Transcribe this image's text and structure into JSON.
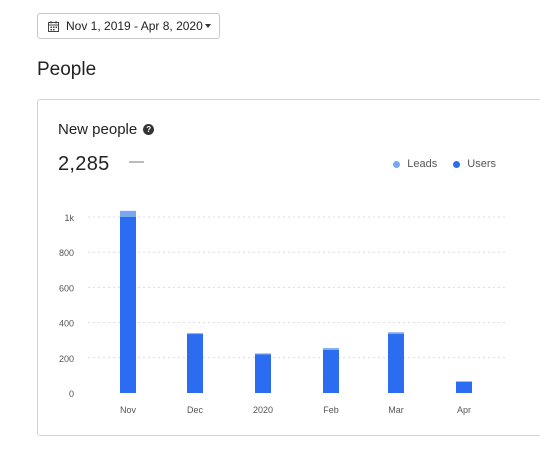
{
  "date_range": {
    "label": "Nov 1, 2019 - Apr 8, 2020"
  },
  "page": {
    "title": "People"
  },
  "card": {
    "title": "New people",
    "total": "2,285",
    "delta": "—"
  },
  "colors": {
    "users": "#2b6cf0",
    "leads": "#79a8ef",
    "grid": "#dcdcdc"
  },
  "chart_data": {
    "type": "bar",
    "stacked": true,
    "categories": [
      "Nov",
      "Dec",
      "2020",
      "Feb",
      "Mar",
      "Apr"
    ],
    "series": [
      {
        "name": "Users",
        "values": [
          1000,
          335,
          220,
          245,
          335,
          65
        ]
      },
      {
        "name": "Leads",
        "values": [
          35,
          5,
          5,
          10,
          10,
          0
        ]
      }
    ],
    "y_ticks": [
      "0",
      "200",
      "400",
      "600",
      "800",
      "1k"
    ],
    "ylim": [
      0,
      1050
    ],
    "grid": true,
    "legend_position": "top-right"
  }
}
